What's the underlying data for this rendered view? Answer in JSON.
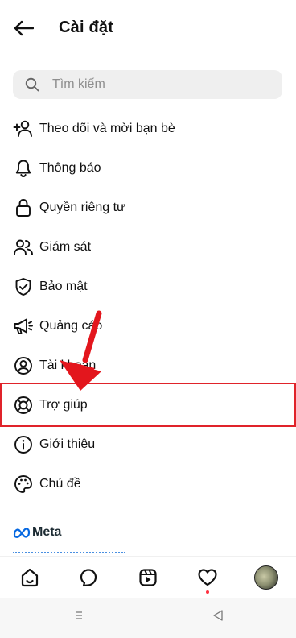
{
  "header": {
    "title": "Cài đặt"
  },
  "search": {
    "placeholder": "Tìm kiếm"
  },
  "menu": {
    "items": [
      {
        "label": "Theo dõi và mời bạn bè",
        "icon": "add-person-icon"
      },
      {
        "label": "Thông báo",
        "icon": "bell-icon"
      },
      {
        "label": "Quyền riêng tư",
        "icon": "lock-icon"
      },
      {
        "label": "Giám sát",
        "icon": "people-icon"
      },
      {
        "label": "Bảo mật",
        "icon": "shield-check-icon"
      },
      {
        "label": "Quảng cáo",
        "icon": "megaphone-icon"
      },
      {
        "label": "Tài khoản",
        "icon": "account-circle-icon"
      },
      {
        "label": "Trợ giúp",
        "icon": "lifebuoy-icon"
      },
      {
        "label": "Giới thiệu",
        "icon": "info-icon"
      },
      {
        "label": "Chủ đề",
        "icon": "palette-icon"
      }
    ]
  },
  "meta": {
    "label": "Meta"
  },
  "annotation": {
    "highlight_color": "#e0232a"
  },
  "bottom_nav": {
    "items": [
      "home-icon",
      "explore-icon",
      "reels-icon",
      "activity-heart-icon",
      "profile-avatar"
    ],
    "notification_dot_color": "#ff3040"
  }
}
